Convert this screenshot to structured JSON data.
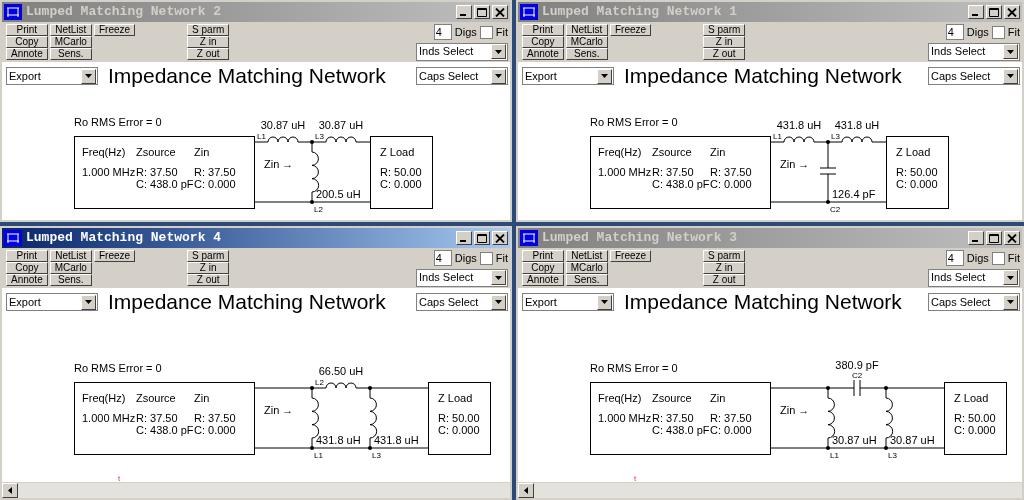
{
  "windows": [
    {
      "title": "Lumped Matching Network 2",
      "active": false,
      "toolbar": {
        "button_columns": [
          [
            "Print",
            "Copy",
            "Annote"
          ],
          [
            "NetList",
            "MCarlo",
            "Sens."
          ],
          [
            "Freeze"
          ]
        ],
        "view_buttons": [
          "S parm",
          "Z in",
          "Z out"
        ],
        "digits": "4",
        "digits_label": "Digs",
        "fit": {
          "label": "Fit",
          "checked": false
        },
        "inds_select": "Inds Select"
      },
      "export_select": "Export",
      "heading": "Impedance Matching Network",
      "caps_select": "Caps Select",
      "circuit": {
        "error_text": "Ro RMS Error = 0",
        "source": {
          "headers": [
            "Freq(Hz)",
            "Zsource",
            "Zin"
          ],
          "freq": "1.000 MHz",
          "zsource": [
            "R: 37.50",
            "C: 438.0 pF"
          ],
          "zin": [
            "R: 37.50",
            "C: 0.000"
          ]
        },
        "zin_label": "Zin →",
        "kind": "tee",
        "components": [
          {
            "kind": "inductor",
            "value": "30.87 uH",
            "designator": "L1"
          },
          {
            "kind": "inductor",
            "value": "30.87 uH",
            "designator": "L3"
          },
          {
            "kind": "inductor",
            "value": "200.5 uH",
            "designator": "L2"
          }
        ],
        "load": {
          "title": "Z Load",
          "lines": [
            "R: 50.00",
            "C: 0.000"
          ]
        }
      }
    },
    {
      "title": "Lumped Matching Network 1",
      "active": false,
      "toolbar": {
        "button_columns": [
          [
            "Print",
            "Copy",
            "Annote"
          ],
          [
            "NetList",
            "MCarlo",
            "Sens."
          ],
          [
            "Freeze"
          ]
        ],
        "view_buttons": [
          "S parm",
          "Z in",
          "Z out"
        ],
        "digits": "4",
        "digits_label": "Digs",
        "fit": {
          "label": "Fit",
          "checked": false
        },
        "inds_select": "Inds Select"
      },
      "export_select": "Export",
      "heading": "Impedance Matching Network",
      "caps_select": "Caps Select",
      "circuit": {
        "error_text": "Ro RMS Error = 0",
        "source": {
          "headers": [
            "Freq(Hz)",
            "Zsource",
            "Zin"
          ],
          "freq": "1.000 MHz",
          "zsource": [
            "R: 37.50",
            "C: 438.0 pF"
          ],
          "zin": [
            "R: 37.50",
            "C: 0.000"
          ]
        },
        "zin_label": "Zin →",
        "kind": "tee",
        "components": [
          {
            "kind": "inductor",
            "value": "431.8 uH",
            "designator": "L1"
          },
          {
            "kind": "inductor",
            "value": "431.8 uH",
            "designator": "L3"
          },
          {
            "kind": "capacitor",
            "value": "126.4 pF",
            "designator": "C2"
          }
        ],
        "load": {
          "title": "Z Load",
          "lines": [
            "R: 50.00",
            "C: 0.000"
          ]
        }
      }
    },
    {
      "title": "Lumped Matching Network 4",
      "active": true,
      "toolbar": {
        "button_columns": [
          [
            "Print",
            "Copy",
            "Annote"
          ],
          [
            "NetList",
            "MCarlo",
            "Sens."
          ],
          [
            "Freeze"
          ]
        ],
        "view_buttons": [
          "S parm",
          "Z in",
          "Z out"
        ],
        "digits": "4",
        "digits_label": "Digs",
        "fit": {
          "label": "Fit",
          "checked": false
        },
        "inds_select": "Inds Select"
      },
      "export_select": "Export",
      "heading": "Impedance Matching Network",
      "caps_select": "Caps Select",
      "circuit": {
        "error_text": "Ro RMS Error = 0",
        "source": {
          "headers": [
            "Freq(Hz)",
            "Zsource",
            "Zin"
          ],
          "freq": "1.000 MHz",
          "zsource": [
            "R: 37.50",
            "C: 438.0 pF"
          ],
          "zin": [
            "R: 37.50",
            "C: 0.000"
          ]
        },
        "zin_label": "Zin →",
        "kind": "pi",
        "components": [
          {
            "kind": "inductor",
            "value": "66.50 uH",
            "designator": "L2"
          },
          {
            "kind": "inductor",
            "value": "431.8 uH",
            "designator": "L1"
          },
          {
            "kind": "inductor",
            "value": "431.8 uH",
            "designator": "L3"
          }
        ],
        "load": {
          "title": "Z Load",
          "lines": [
            "R: 50.00",
            "C: 0.000"
          ]
        }
      },
      "note": "t",
      "horizontal_scrollbar": true
    },
    {
      "title": "Lumped Matching Network 3",
      "active": false,
      "toolbar": {
        "button_columns": [
          [
            "Print",
            "Copy",
            "Annote"
          ],
          [
            "NetList",
            "MCarlo",
            "Sens."
          ],
          [
            "Freeze"
          ]
        ],
        "view_buttons": [
          "S parm",
          "Z in",
          "Z out"
        ],
        "digits": "4",
        "digits_label": "Digs",
        "fit": {
          "label": "Fit",
          "checked": false
        },
        "inds_select": "Inds Select"
      },
      "export_select": "Export",
      "heading": "Impedance Matching Network",
      "caps_select": "Caps Select",
      "circuit": {
        "error_text": "Ro RMS Error = 0",
        "source": {
          "headers": [
            "Freq(Hz)",
            "Zsource",
            "Zin"
          ],
          "freq": "1.000 MHz",
          "zsource": [
            "R: 37.50",
            "C: 438.0 pF"
          ],
          "zin": [
            "R: 37.50",
            "C: 0.000"
          ]
        },
        "zin_label": "Zin →",
        "kind": "pi",
        "components": [
          {
            "kind": "capacitor",
            "value": "380.9 pF",
            "designator": "C2"
          },
          {
            "kind": "inductor",
            "value": "30.87 uH",
            "designator": "L1"
          },
          {
            "kind": "inductor",
            "value": "30.87 uH",
            "designator": "L3"
          }
        ],
        "load": {
          "title": "Z Load",
          "lines": [
            "R: 50.00",
            "C: 0.000"
          ]
        }
      },
      "note": "t",
      "horizontal_scrollbar": true
    }
  ]
}
